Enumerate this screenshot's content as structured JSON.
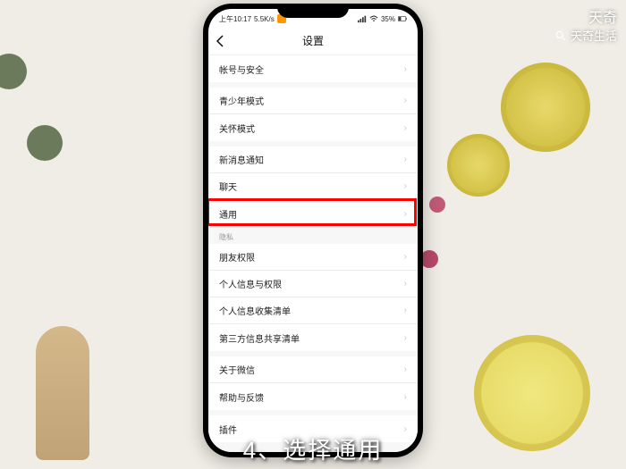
{
  "watermark": {
    "line1": "天奇",
    "line2": "天奇生活"
  },
  "statusbar": {
    "time": "上午10:17",
    "net_speed": "5.5K/s",
    "battery_pct": "35%"
  },
  "navbar": {
    "title": "设置"
  },
  "groups": [
    {
      "items": [
        "帐号与安全"
      ]
    },
    {
      "items": [
        "青少年模式",
        "关怀模式"
      ]
    },
    {
      "items": [
        "新消息通知",
        "聊天",
        "通用"
      ]
    },
    {
      "section": "隐私",
      "items": [
        "朋友权限",
        "个人信息与权限",
        "个人信息收集清单",
        "第三方信息共享清单"
      ]
    },
    {
      "items": [
        "关于微信",
        "帮助与反馈"
      ]
    },
    {
      "items": [
        "插件"
      ]
    }
  ],
  "highlighted_item": "通用",
  "caption": "4、选择通用"
}
